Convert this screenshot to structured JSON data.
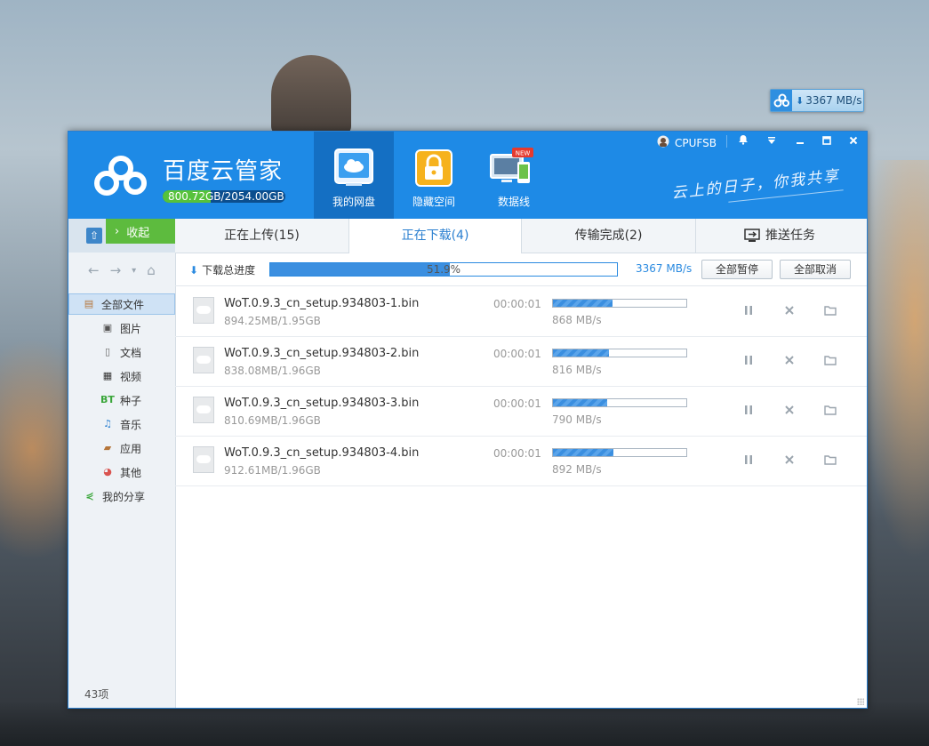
{
  "float_widget": {
    "speed": "3367 MB/s",
    "icons": [
      "baidu-cloud-logo",
      "download-arrow-icon"
    ]
  },
  "app": {
    "name": "百度云管家",
    "quota": {
      "used": "800.72GB",
      "total": "2054.00GB",
      "text": "800.72GB/2054.00GB",
      "fraction": 0.39
    },
    "slogan": "云上的日子，你我共享"
  },
  "nav": [
    {
      "label": "我的网盘",
      "icon": "cloud-drive-icon",
      "active": true
    },
    {
      "label": "隐藏空间",
      "icon": "lock-icon",
      "active": false
    },
    {
      "label": "数据线",
      "icon": "devices-icon",
      "badge": "NEW",
      "active": false
    }
  ],
  "user": {
    "name": "CPUFSB"
  },
  "window_controls": [
    "bell-icon",
    "dropdown-icon",
    "minimize-icon",
    "maximize-icon",
    "close-icon"
  ],
  "sidebar": {
    "collapse_label": "收起",
    "items": [
      {
        "label": "全部文件",
        "icon": "all-files-icon",
        "selected": true,
        "indent": false
      },
      {
        "label": "图片",
        "icon": "image-icon",
        "indent": true
      },
      {
        "label": "文档",
        "icon": "document-icon",
        "indent": true
      },
      {
        "label": "视频",
        "icon": "video-icon",
        "indent": true
      },
      {
        "label": "种子",
        "icon": "bt-icon",
        "indent": true,
        "glyph": "BT"
      },
      {
        "label": "音乐",
        "icon": "music-icon",
        "indent": true
      },
      {
        "label": "应用",
        "icon": "app-icon",
        "indent": true
      },
      {
        "label": "其他",
        "icon": "other-icon",
        "indent": true
      },
      {
        "label": "我的分享",
        "icon": "share-icon",
        "indent": false
      }
    ],
    "footer": "43项"
  },
  "tabs": [
    {
      "label": "正在上传(15)",
      "active": false
    },
    {
      "label": "正在下载(4)",
      "active": true
    },
    {
      "label": "传输完成(2)",
      "active": false
    }
  ],
  "push_task": {
    "label": "推送任务",
    "icon": "push-task-icon"
  },
  "overall": {
    "label": "下载总进度",
    "percent_text": "51.9%",
    "fraction": 0.519,
    "speed": "3367 MB/s",
    "pause_all": "全部暂停",
    "cancel_all": "全部取消"
  },
  "downloads": [
    {
      "name": "WoT.0.9.3_cn_setup.934803-1.bin",
      "size": "894.25MB/1.95GB",
      "time": "00:00:01",
      "speed": "868 MB/s",
      "fraction": 0.448
    },
    {
      "name": "WoT.0.9.3_cn_setup.934803-2.bin",
      "size": "838.08MB/1.96GB",
      "time": "00:00:01",
      "speed": "816 MB/s",
      "fraction": 0.418
    },
    {
      "name": "WoT.0.9.3_cn_setup.934803-3.bin",
      "size": "810.69MB/1.96GB",
      "time": "00:00:01",
      "speed": "790 MB/s",
      "fraction": 0.404
    },
    {
      "name": "WoT.0.9.3_cn_setup.934803-4.bin",
      "size": "912.61MB/1.96GB",
      "time": "00:00:01",
      "speed": "892 MB/s",
      "fraction": 0.455
    }
  ],
  "row_action_icons": [
    "pause-icon",
    "cancel-icon",
    "open-folder-icon"
  ],
  "colors": {
    "header": "#1e8ae6",
    "accent": "#2a8ae0",
    "green": "#5dbb3e"
  }
}
